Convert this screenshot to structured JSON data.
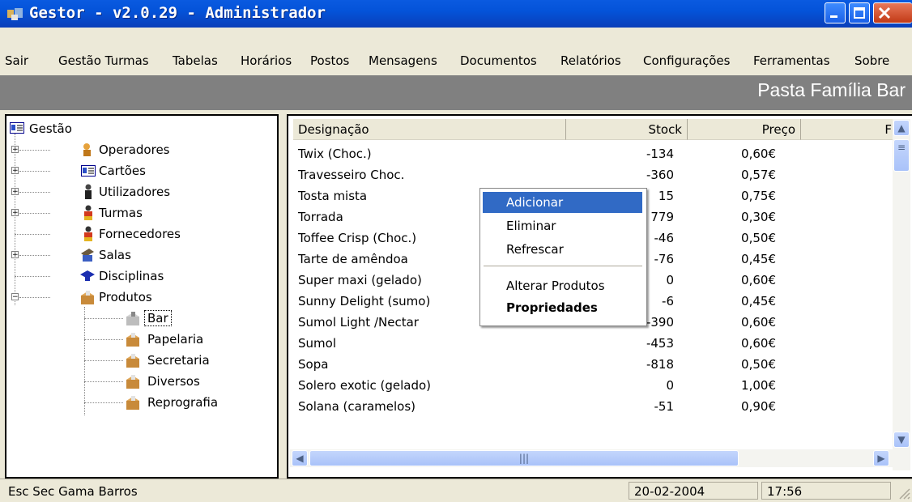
{
  "window": {
    "title": "Gestor - v2.0.29 - Administrador",
    "icon": "app-icon",
    "controls": [
      "minimize-icon",
      "maximize-icon",
      "close-icon"
    ]
  },
  "menu": [
    "Sair",
    "Gestão Turmas",
    "Tabelas",
    "Horários",
    "Postos",
    "Mensagens",
    "Documentos",
    "Relatórios",
    "Configurações",
    "Ferramentas",
    "Sobre"
  ],
  "header": {
    "folder_title": "Pasta Família Bar"
  },
  "tree": {
    "root": "Gestão",
    "items": [
      {
        "label": "Operadores",
        "icon": "operators-icon"
      },
      {
        "label": "Cartões",
        "icon": "card-icon"
      },
      {
        "label": "Utilizadores",
        "icon": "user-icon"
      },
      {
        "label": "Turmas",
        "icon": "group-icon"
      },
      {
        "label": "Fornecedores",
        "icon": "supplier-icon"
      },
      {
        "label": "Salas",
        "icon": "room-icon"
      },
      {
        "label": "Disciplinas",
        "icon": "discipline-icon"
      },
      {
        "label": "Produtos",
        "icon": "products-icon"
      }
    ],
    "children": [
      "Bar",
      "Papelaria",
      "Secretaria",
      "Diversos",
      "Reprografia"
    ]
  },
  "table": {
    "columns": [
      "Designação",
      "Stock",
      "Preço",
      "F"
    ],
    "rows": [
      [
        "Twix (Choc.)",
        "-134",
        "0,60€"
      ],
      [
        "Travesseiro Choc.",
        "-360",
        "0,57€"
      ],
      [
        "Tosta mista",
        "15",
        "0,75€"
      ],
      [
        "Torrada",
        "779",
        "0,30€"
      ],
      [
        "Toffee Crisp (Choc.)",
        "-46",
        "0,50€"
      ],
      [
        "Tarte de amêndoa",
        "-76",
        "0,45€"
      ],
      [
        "Super maxi (gelado)",
        "0",
        "0,60€"
      ],
      [
        "Sunny Delight (sumo)",
        "-6",
        "0,45€"
      ],
      [
        "Sumol Light /Nectar",
        "-390",
        "0,60€"
      ],
      [
        "Sumol",
        "-453",
        "0,60€"
      ],
      [
        "Sopa",
        "-818",
        "0,50€"
      ],
      [
        "Solero exotic (gelado)",
        "0",
        "1,00€"
      ],
      [
        "Solana (caramelos)",
        "-51",
        "0,90€"
      ]
    ]
  },
  "context_menu": {
    "items": [
      "Adicionar",
      "Eliminar",
      "Refrescar"
    ],
    "items2": [
      "Alterar Produtos",
      "Propriedades"
    ]
  },
  "status": {
    "school": "Esc Sec Gama Barros",
    "date": "20-02-2004",
    "time": "17:56"
  },
  "colors": {
    "titlebar": "#0453d9",
    "selection": "#316ac5",
    "header_band": "#808080"
  }
}
